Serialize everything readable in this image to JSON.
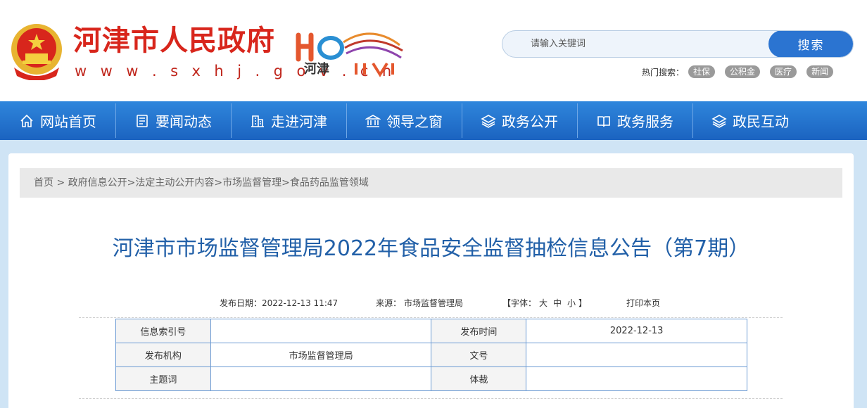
{
  "header": {
    "site_name": "河津市人民政府",
    "site_url": "w w w . s x h j . g o v . c n",
    "logo_text": "河津"
  },
  "search": {
    "placeholder": "请输入关键词",
    "button_label": "搜索"
  },
  "hot": {
    "label": "热门搜索：",
    "tags": [
      "社保",
      "公积金",
      "医疗",
      "新闻"
    ]
  },
  "nav": {
    "items": [
      {
        "label": "网站首页",
        "icon": "home-icon"
      },
      {
        "label": "要闻动态",
        "icon": "news-icon"
      },
      {
        "label": "走进河津",
        "icon": "building-icon"
      },
      {
        "label": "领导之窗",
        "icon": "institution-icon"
      },
      {
        "label": "政务公开",
        "icon": "layers-icon"
      },
      {
        "label": "政务服务",
        "icon": "book-icon"
      },
      {
        "label": "政民互动",
        "icon": "layers-icon"
      }
    ]
  },
  "breadcrumb": "首页 > 政府信息公开>法定主动公开内容>市场监督管理>食品药品监管领域",
  "article": {
    "title": "河津市市场监督管理局2022年食品安全监督抽检信息公告（第7期）",
    "publish_label": "发布日期：2022-12-13 11:47",
    "source_label": "来源： 市场监督管理局",
    "font_label": "【字体：",
    "font_large": "大",
    "font_medium": "中",
    "font_small": "小",
    "font_end": "】",
    "print_label": "打印本页"
  },
  "info_table": {
    "index_no_label": "信息索引号",
    "index_no_value": "",
    "publish_time_label": "发布时间",
    "publish_time_value": "2022-12-13",
    "agency_label": "发布机构",
    "agency_value": "市场监督管理局",
    "doc_no_label": "文号",
    "doc_no_value": "",
    "subject_label": "主题词",
    "subject_value": "",
    "genre_label": "体裁",
    "genre_value": ""
  }
}
